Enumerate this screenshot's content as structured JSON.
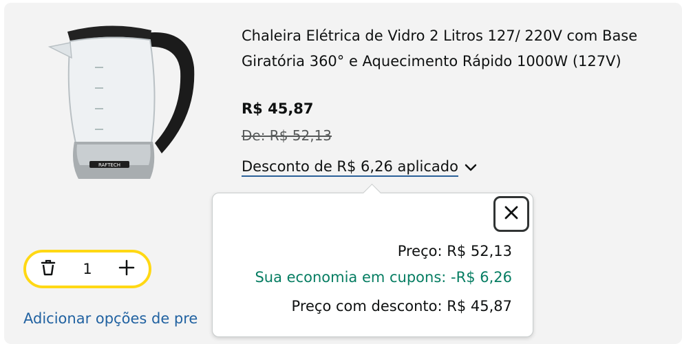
{
  "product": {
    "title": "Chaleira Elétrica de Vidro 2 Litros 127/ 220V com Base Giratória 360° e Aquecimento Rápido 1000W (127V)",
    "price": "R$ 45,87",
    "list_price": "De: R$ 52,13",
    "discount_label": "Desconto de R$ 6,26 aplicado",
    "image_brand_text": "RAFTECH"
  },
  "quantity": {
    "value": "1",
    "delete_icon": "trash-icon",
    "increment_icon": "plus-icon"
  },
  "links": {
    "add_options": "Adicionar opções de pre"
  },
  "popover": {
    "price_line": "Preço: R$ 52,13",
    "savings_line": "Sua economia em cupons: -R$ 6,26",
    "discounted_line": "Preço com desconto: R$ 45,87",
    "close_icon": "close-icon"
  },
  "colors": {
    "background": "#f3f3f3",
    "qty_border": "#ffd814",
    "link": "#2162a1",
    "savings": "#067d62"
  }
}
